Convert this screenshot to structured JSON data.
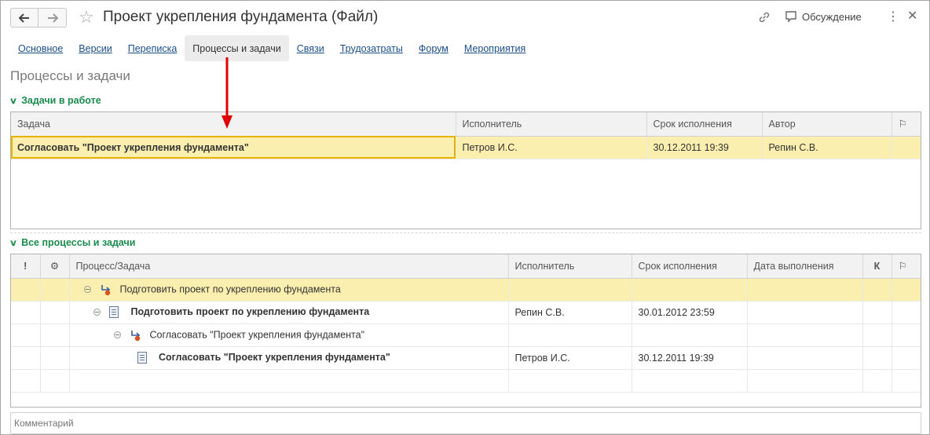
{
  "window": {
    "title": "Проект укрепления фундамента (Файл)"
  },
  "header": {
    "back_icon": "arrow-left-icon",
    "forward_icon": "arrow-right-icon",
    "discussion_label": "Обсуждение"
  },
  "tabs": [
    {
      "label": "Основное"
    },
    {
      "label": "Версии"
    },
    {
      "label": "Переписка"
    },
    {
      "label": "Процессы и задачи",
      "active": true
    },
    {
      "label": "Связи"
    },
    {
      "label": "Трудозатраты"
    },
    {
      "label": "Форум"
    },
    {
      "label": "Мероприятия"
    }
  ],
  "section_title": "Процессы и задачи",
  "tasks_in_progress": {
    "header": "Задачи в работе",
    "columns": [
      "Задача",
      "Исполнитель",
      "Срок исполнения",
      "Автор"
    ],
    "rows": [
      {
        "task": "Согласовать \"Проект укрепления фундамента\"",
        "executor": "Петров И.С.",
        "deadline": "30.12.2011 19:39",
        "author": "Репин С.В."
      }
    ]
  },
  "all_processes": {
    "header": "Все процессы и задачи",
    "columns": [
      "!",
      "",
      "Процесс/Задача",
      "Исполнитель",
      "Срок исполнения",
      "Дата выполнения",
      "К",
      ""
    ],
    "rows": [
      {
        "name": "Подготовить проект по укреплению фундамента",
        "type": "process",
        "executor": "",
        "deadline": ""
      },
      {
        "name": "Подготовить проект по укреплению фундамента",
        "type": "task",
        "executor": "Репин С.В.",
        "deadline": "30.01.2012 23:59"
      },
      {
        "name": "Согласовать \"Проект укрепления фундамента\"",
        "type": "process",
        "executor": "",
        "deadline": ""
      },
      {
        "name": "Согласовать \"Проект укрепления фундамента\"",
        "type": "task",
        "executor": "Петров И.С.",
        "deadline": "30.12.2011 19:39"
      }
    ]
  },
  "comment": {
    "placeholder": "Комментарий"
  },
  "colors": {
    "accent_green": "#1c8c4e",
    "selection": "#fbefb0",
    "date_red": "#a01010",
    "arrow_red": "#e00000"
  }
}
